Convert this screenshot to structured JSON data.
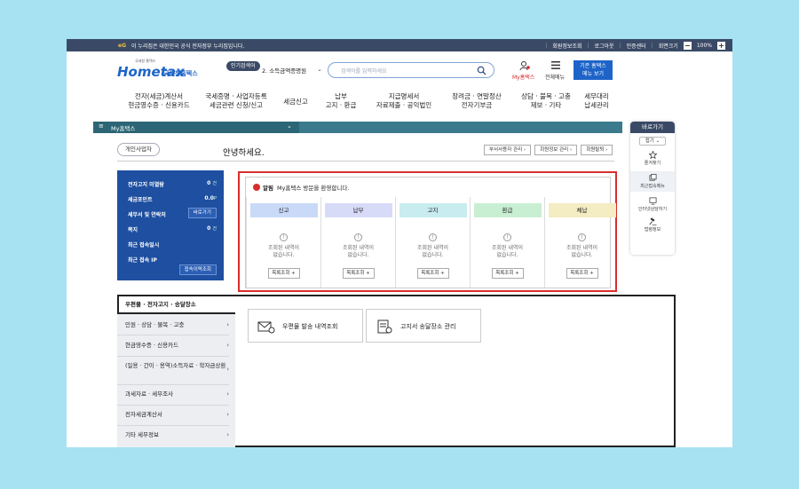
{
  "topbar": {
    "eg_label": "eG",
    "gov_notice": "이 누리집은 대한민국 공식 전자정부 누리집입니다.",
    "links": [
      "회원정보조회",
      "로그아웃",
      "인증센터",
      "회면크기"
    ],
    "zoom_minus": "−",
    "zoom_value": "100%",
    "zoom_plus": "+"
  },
  "header": {
    "logo_small": "국세청 홈택스",
    "logo_main": "Hometax",
    "logo_sub": "국세청홈택스",
    "popular_label": "인기검색어",
    "popular_term": "2. 소득금액증명원",
    "search_placeholder": "검색어를 입력하세요",
    "my_hometax": "My홈택스",
    "all_menu": "전체메뉴",
    "old_hometax_line1": "기존 홈택스",
    "old_hometax_line2": "메뉴 보기"
  },
  "nav": [
    {
      "l1": "전자(세금)계산서",
      "l2": "현금영수증 · 신용카드"
    },
    {
      "l1": "국세증명 · 사업자등록",
      "l2": "세금관련 신청/신고"
    },
    {
      "l1": "세금신고",
      "l2": ""
    },
    {
      "l1": "납부",
      "l2": "고지 · 환급"
    },
    {
      "l1": "지급명세서",
      "l2": "자료제출 · 공익법인"
    },
    {
      "l1": "장려금 · 연말정산",
      "l2": "전자기부금"
    },
    {
      "l1": "상담 · 불복 · 고충",
      "l2": "제보 · 기타"
    },
    {
      "l1": "세무대리",
      "l2": "납세관리"
    }
  ],
  "mybar": {
    "label": "My홈택스"
  },
  "quick": {
    "title": "바로가기",
    "fold": "접기",
    "items": [
      "즐겨찾기",
      "최근접속메뉴",
      "인터넷상담하기",
      "법령정보"
    ]
  },
  "profile": {
    "business_type": "개인사업자",
    "greeting": "안녕하세요.",
    "buttons": [
      "부서사용자 관리",
      "회원정보 관리",
      "회원탈퇴"
    ]
  },
  "infobox": {
    "rows": [
      {
        "label": "전자고지 미열람",
        "value": "0",
        "unit": "건"
      },
      {
        "label": "세금포인트",
        "value": "0.0",
        "unit": "P"
      },
      {
        "label": "세무서 및 연락처",
        "value": "",
        "unit": ""
      },
      {
        "label": "쪽지",
        "value": "0",
        "unit": "건"
      },
      {
        "label": "최근 접속일시",
        "value": "",
        "unit": ""
      },
      {
        "label": "최근 접속 IP",
        "value": "",
        "unit": ""
      }
    ],
    "shortcut_button": "바로가기",
    "history_button": "접속이력조회"
  },
  "notice": {
    "badge": "알림",
    "message": "My홈택스 방문을 환영합니다.",
    "columns": [
      {
        "tab": "신고",
        "color": "#c9daf8"
      },
      {
        "tab": "납부",
        "color": "#d7dbf8"
      },
      {
        "tab": "고지",
        "color": "#c8ecf0"
      },
      {
        "tab": "환급",
        "color": "#c8efd2"
      },
      {
        "tab": "체납",
        "color": "#f4ecc2"
      }
    ],
    "empty_line1": "조회된 내역이",
    "empty_line2": "없습니다.",
    "list_button": "목록조회"
  },
  "bottom": {
    "title": "우편물 · 전자고지 · 송달장소",
    "sidebar": [
      {
        "label": "민원 · 상담 · 불복 · 고충"
      },
      {
        "label": "현금영수증 · 신용카드"
      },
      {
        "label": "(일용 · 간이 · 용역)소득자료 · 학자금상환"
      },
      {
        "label": "과세자료 · 세무조사"
      },
      {
        "label": "전자세금계산서"
      },
      {
        "label": "기타 세무정보"
      }
    ],
    "cards": [
      "우편물 발송 내역조회",
      "고지서 송달장소 관리"
    ]
  }
}
